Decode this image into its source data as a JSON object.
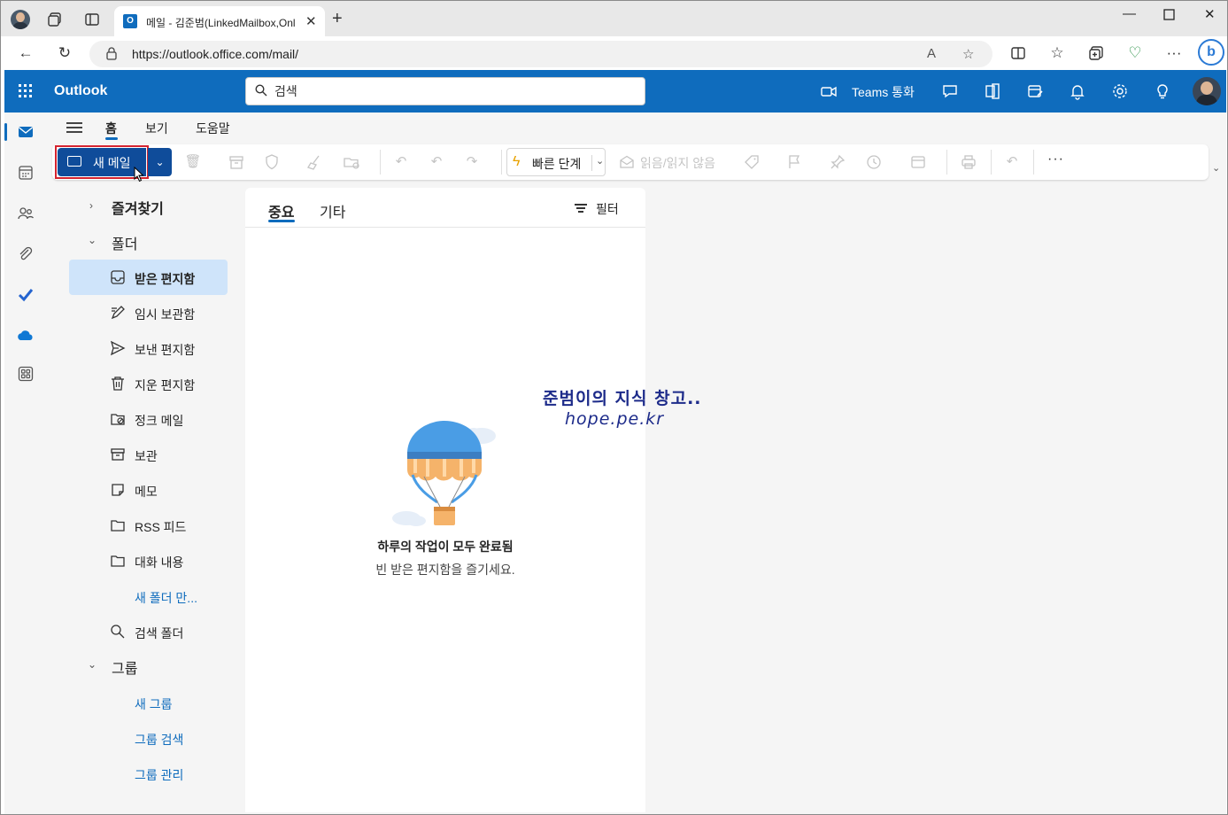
{
  "browser": {
    "tab_title": "메일 - 김준범(LinkedMailbox,Onl",
    "url": "https://outlook.office.com/mail/"
  },
  "header": {
    "app_name": "Outlook",
    "search_placeholder": "검색",
    "teams_call_label": "Teams 통화"
  },
  "ribbon": {
    "tabs": [
      "홈",
      "보기",
      "도움말"
    ],
    "active_tab": "홈"
  },
  "commands": {
    "new_mail_label": "새 메일",
    "quick_steps_label": "빠른 단계",
    "read_unread_label": "읽음/읽지 않음",
    "more_label": "···"
  },
  "folders": {
    "favorites_label": "즐겨찾기",
    "folders_label": "폴더",
    "items": [
      {
        "label": "받은 편지함",
        "icon": "inbox-icon",
        "selected": true
      },
      {
        "label": "임시 보관함",
        "icon": "drafts-icon",
        "selected": false
      },
      {
        "label": "보낸 편지함",
        "icon": "sent-icon",
        "selected": false
      },
      {
        "label": "지운 편지함",
        "icon": "trash-icon",
        "selected": false
      },
      {
        "label": "정크 메일",
        "icon": "junk-icon",
        "selected": false
      },
      {
        "label": "보관",
        "icon": "archive-icon",
        "selected": false
      },
      {
        "label": "메모",
        "icon": "note-icon",
        "selected": false
      },
      {
        "label": "RSS 피드",
        "icon": "folder-icon",
        "selected": false
      },
      {
        "label": "대화 내용",
        "icon": "folder-icon",
        "selected": false
      }
    ],
    "new_folder_label": "새 폴더 만...",
    "search_folder_label": "검색 폴더",
    "groups_label": "그룹",
    "group_links": [
      "새 그룹",
      "그룹 검색",
      "그룹 관리"
    ]
  },
  "message_list": {
    "tabs": [
      "중요",
      "기타"
    ],
    "filter_label": "필터",
    "empty_title": "하루의 작업이 모두 완료됨",
    "empty_subtitle": "빈 받은 편지함을 즐기세요."
  },
  "watermark": {
    "line1": "준범이의 지식 창고..",
    "line2": "hope.pe.kr"
  },
  "colors": {
    "brand_blue": "#0f6cbd",
    "new_mail_bg": "#0f4c9a",
    "highlight_outline": "#d4232f",
    "selected_folder_bg": "#cfe4fa"
  }
}
